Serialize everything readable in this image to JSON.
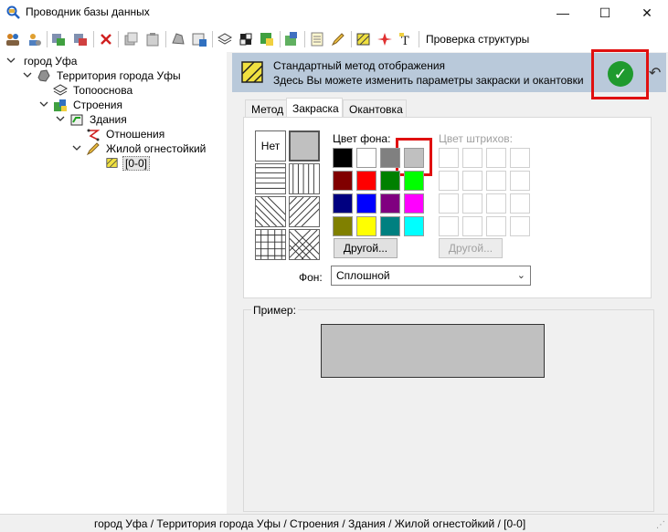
{
  "window": {
    "title": "Проводник базы данных",
    "minimize_glyph": "—",
    "maximize_glyph": "☐",
    "close_glyph": "✕"
  },
  "toolbar": {
    "structure_check_label": "Проверка структуры"
  },
  "tree": {
    "nodes": [
      {
        "label": "город Уфа",
        "icon": "city-icon"
      },
      {
        "label": "Территория города Уфы",
        "icon": "territory-icon"
      },
      {
        "label": "Топооснова",
        "icon": "layers-icon"
      },
      {
        "label": "Строения",
        "icon": "buildings-icon"
      },
      {
        "label": "Здания",
        "icon": "building-icon"
      },
      {
        "label": "Отношения",
        "icon": "relations-icon"
      },
      {
        "label": "Жилой огнестойкий",
        "icon": "pencil-icon"
      },
      {
        "label": "[0-0]",
        "icon": "hatch-icon"
      }
    ]
  },
  "banner": {
    "line1": "Стандартный метод отображения",
    "line2": "Здесь Вы можете изменить параметры закраски и окантовки",
    "ok_glyph": "✓",
    "undo_glyph": "↶"
  },
  "tabs": [
    {
      "label": "Метод",
      "active": false
    },
    {
      "label": "Закраска",
      "active": true
    },
    {
      "label": "Окантовка",
      "active": false
    }
  ],
  "fill": {
    "none_label": "Нет",
    "bg_color_label": "Цвет фона:",
    "hatch_color_label": "Цвет штрихов:",
    "other_label": "Другой...",
    "other_disabled_label": "Другой...",
    "bg_label": "Фон:",
    "bg_value": "Сплошной",
    "colors": [
      "#000000",
      "#ffffff",
      "#808080",
      "#c0c0c0",
      "#800000",
      "#ff0000",
      "#008000",
      "#00ff00",
      "#000080",
      "#0000ff",
      "#800080",
      "#ff00ff",
      "#808000",
      "#ffff00",
      "#008080",
      "#00ffff"
    ],
    "selected_color": "#c0c0c0"
  },
  "preview": {
    "label": "Пример:",
    "fill_color": "#c0c0c0"
  },
  "status": {
    "path": "город Уфа / Территория города Уфы / Строения / Здания / Жилой огнестойкий / [0-0]"
  }
}
